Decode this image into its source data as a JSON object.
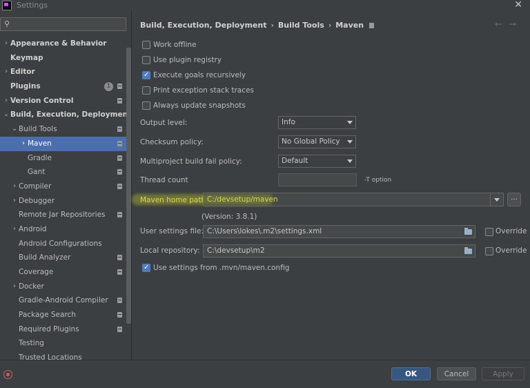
{
  "window": {
    "title": "Settings",
    "close_glyph": "✕"
  },
  "search": {
    "placeholder": "",
    "value": "",
    "icon": "search-icon"
  },
  "sidebar": {
    "items": [
      {
        "label": "Appearance & Behavior",
        "level": 0,
        "bold": true,
        "arrow": "›",
        "badge": false,
        "selected": false
      },
      {
        "label": "Keymap",
        "level": 0,
        "bold": true,
        "arrow": "",
        "badge": false,
        "selected": false
      },
      {
        "label": "Editor",
        "level": 0,
        "bold": true,
        "arrow": "›",
        "badge": false,
        "selected": false
      },
      {
        "label": "Plugins",
        "level": 0,
        "bold": true,
        "arrow": "",
        "badge": true,
        "count": "1",
        "selected": false
      },
      {
        "label": "Version Control",
        "level": 0,
        "bold": true,
        "arrow": "›",
        "badge": true,
        "selected": false
      },
      {
        "label": "Build, Execution, Deployment",
        "level": 0,
        "bold": true,
        "arrow": "⌄",
        "badge": false,
        "selected": false
      },
      {
        "label": "Build Tools",
        "level": 1,
        "bold": false,
        "arrow": "⌄",
        "badge": true,
        "selected": false
      },
      {
        "label": "Maven",
        "level": 2,
        "bold": false,
        "arrow": "›",
        "badge": true,
        "selected": true
      },
      {
        "label": "Gradle",
        "level": 2,
        "bold": false,
        "arrow": "",
        "badge": true,
        "selected": false
      },
      {
        "label": "Gant",
        "level": 2,
        "bold": false,
        "arrow": "",
        "badge": true,
        "selected": false
      },
      {
        "label": "Compiler",
        "level": 1,
        "bold": false,
        "arrow": "›",
        "badge": true,
        "selected": false
      },
      {
        "label": "Debugger",
        "level": 1,
        "bold": false,
        "arrow": "›",
        "badge": false,
        "selected": false
      },
      {
        "label": "Remote Jar Repositories",
        "level": 1,
        "bold": false,
        "arrow": "",
        "badge": true,
        "selected": false
      },
      {
        "label": "Android",
        "level": 1,
        "bold": false,
        "arrow": "›",
        "badge": false,
        "selected": false
      },
      {
        "label": "Android Configurations",
        "level": 1,
        "bold": false,
        "arrow": "",
        "badge": false,
        "selected": false
      },
      {
        "label": "Build Analyzer",
        "level": 1,
        "bold": false,
        "arrow": "",
        "badge": true,
        "selected": false
      },
      {
        "label": "Coverage",
        "level": 1,
        "bold": false,
        "arrow": "",
        "badge": true,
        "selected": false
      },
      {
        "label": "Docker",
        "level": 1,
        "bold": false,
        "arrow": "›",
        "badge": false,
        "selected": false
      },
      {
        "label": "Gradle-Android Compiler",
        "level": 1,
        "bold": false,
        "arrow": "",
        "badge": true,
        "selected": false
      },
      {
        "label": "Package Search",
        "level": 1,
        "bold": false,
        "arrow": "",
        "badge": true,
        "selected": false
      },
      {
        "label": "Required Plugins",
        "level": 1,
        "bold": false,
        "arrow": "",
        "badge": true,
        "selected": false
      },
      {
        "label": "Testing",
        "level": 1,
        "bold": false,
        "arrow": "",
        "badge": false,
        "selected": false
      },
      {
        "label": "Trusted Locations",
        "level": 1,
        "bold": false,
        "arrow": "",
        "badge": false,
        "selected": false
      }
    ]
  },
  "breadcrumb": {
    "parts": [
      "Build, Execution, Deployment",
      "Build Tools",
      "Maven"
    ],
    "sep": "›"
  },
  "nav": {
    "back": "←",
    "forward": "→"
  },
  "checkboxes": [
    {
      "label": "Work offline",
      "checked": false
    },
    {
      "label": "Use plugin registry",
      "checked": false
    },
    {
      "label": "Execute goals recursively",
      "checked": true
    },
    {
      "label": "Print exception stack traces",
      "checked": false
    },
    {
      "label": "Always update snapshots",
      "checked": false
    }
  ],
  "fields": {
    "output_level": {
      "label": "Output level:",
      "value": "Info"
    },
    "checksum_policy": {
      "label": "Checksum policy:",
      "value": "No Global Policy"
    },
    "multiproject_policy": {
      "label": "Multiproject build fail policy:",
      "value": "Default"
    },
    "thread_count": {
      "label": "Thread count",
      "value": "",
      "hint": "-T option"
    },
    "maven_home": {
      "label": "Maven home path:",
      "value": "C:/devsetup/maven",
      "browse": "..."
    },
    "version": "(Version: 3.8.1)",
    "user_settings": {
      "label": "User settings file:",
      "value": "C:\\Users\\lokes\\.m2\\settings.xml",
      "override_label": "Override",
      "override": false
    },
    "local_repo": {
      "label": "Local repository:",
      "value": "C:\\devsetup\\m2",
      "override_label": "Override",
      "override": false
    },
    "use_mvn_config": {
      "label": "Use settings from .mvn/maven.config",
      "checked": true
    }
  },
  "buttons": {
    "ok": "OK",
    "cancel": "Cancel",
    "apply": "Apply"
  },
  "colors": {
    "accent": "#4b6eaf",
    "highlight": "#d5d84a",
    "ok_button": "#365880"
  }
}
